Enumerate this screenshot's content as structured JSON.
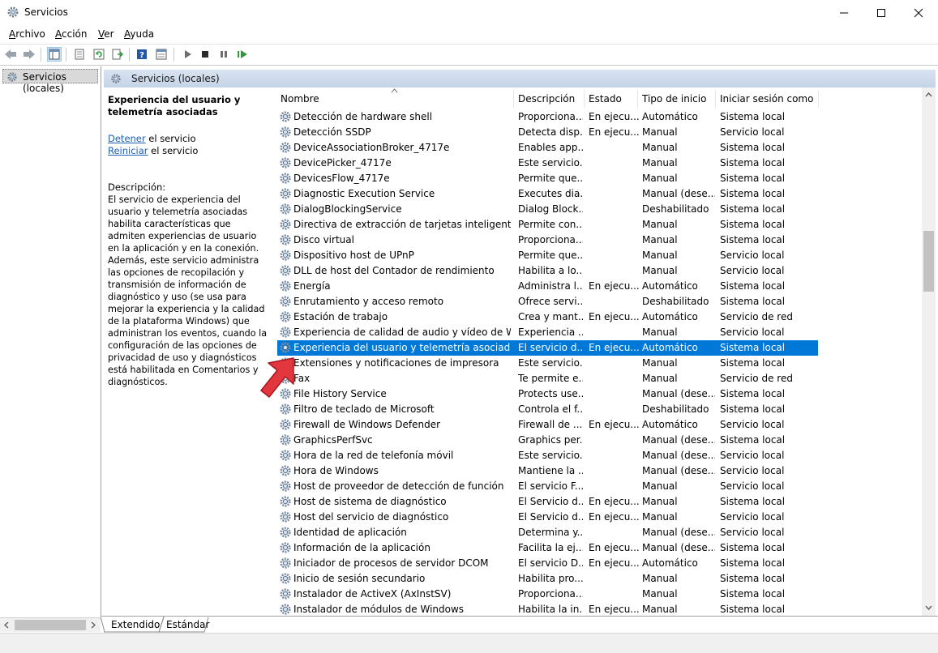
{
  "window": {
    "title": "Servicios"
  },
  "menu": [
    {
      "label": "Archivo",
      "ul": "A",
      "rest": "rchivo"
    },
    {
      "label": "Acción",
      "ul": "A",
      "rest": "cción"
    },
    {
      "label": "Ver",
      "ul": "V",
      "rest": "er"
    },
    {
      "label": "Ayuda",
      "ul": "A",
      "rest": "yuda"
    }
  ],
  "tree": {
    "item": "Servicios (locales)"
  },
  "pane": {
    "header": "Servicios (locales)"
  },
  "detail": {
    "title": "Experiencia del usuario y telemetría asociadas",
    "stop_link": "Detener",
    "stop_rest": " el servicio",
    "restart_link": "Reiniciar",
    "restart_rest": " el servicio",
    "desc_label": "Descripción:",
    "description": "El servicio de experiencia del usuario y telemetría asociadas habilita características que admiten experiencias de usuario en la aplicación y en la conexión. Además, este servicio administra las opciones de recopilación y transmisión de información de diagnóstico y uso (se usa para mejorar la experiencia y la calidad de la plataforma Windows) que administran los eventos, cuando la configuración de las opciones de privacidad de uso y diagnósticos está habilitada en Comentarios y diagnósticos."
  },
  "columns": {
    "name": "Nombre",
    "description": "Descripción",
    "status": "Estado",
    "startup": "Tipo de inicio",
    "logon": "Iniciar sesión como"
  },
  "services": [
    {
      "name": "Detección de hardware shell",
      "desc": "Proporciona...",
      "status": "En ejecu...",
      "startup": "Automático",
      "logon": "Sistema local"
    },
    {
      "name": "Detección SSDP",
      "desc": "Detecta disp...",
      "status": "En ejecu...",
      "startup": "Manual",
      "logon": "Servicio local"
    },
    {
      "name": "DeviceAssociationBroker_4717e",
      "desc": "Enables app...",
      "status": "",
      "startup": "Manual",
      "logon": "Sistema local"
    },
    {
      "name": "DevicePicker_4717e",
      "desc": "Este servicio...",
      "status": "",
      "startup": "Manual",
      "logon": "Sistema local"
    },
    {
      "name": "DevicesFlow_4717e",
      "desc": "Permite que...",
      "status": "",
      "startup": "Manual",
      "logon": "Sistema local"
    },
    {
      "name": "Diagnostic Execution Service",
      "desc": "Executes dia...",
      "status": "",
      "startup": "Manual (dese...",
      "logon": "Sistema local"
    },
    {
      "name": "DialogBlockingService",
      "desc": "Dialog Block...",
      "status": "",
      "startup": "Deshabilitado",
      "logon": "Sistema local"
    },
    {
      "name": "Directiva de extracción de tarjetas inteligentes",
      "desc": "Permite con...",
      "status": "",
      "startup": "Manual",
      "logon": "Sistema local"
    },
    {
      "name": "Disco virtual",
      "desc": "Proporciona...",
      "status": "",
      "startup": "Manual",
      "logon": "Sistema local"
    },
    {
      "name": "Dispositivo host de UPnP",
      "desc": "Permite que...",
      "status": "",
      "startup": "Manual",
      "logon": "Servicio local"
    },
    {
      "name": "DLL de host del Contador de rendimiento",
      "desc": "Habilita a lo...",
      "status": "",
      "startup": "Manual",
      "logon": "Servicio local"
    },
    {
      "name": "Energía",
      "desc": "Administra l...",
      "status": "En ejecu...",
      "startup": "Automático",
      "logon": "Sistema local"
    },
    {
      "name": "Enrutamiento y acceso remoto",
      "desc": "Ofrece servi...",
      "status": "",
      "startup": "Deshabilitado",
      "logon": "Sistema local"
    },
    {
      "name": "Estación de trabajo",
      "desc": "Crea y mant...",
      "status": "En ejecu...",
      "startup": "Automático",
      "logon": "Servicio de red"
    },
    {
      "name": "Experiencia de calidad de audio y vídeo de Wind...",
      "desc": "Experiencia ...",
      "status": "",
      "startup": "Manual",
      "logon": "Servicio local"
    },
    {
      "name": "Experiencia del usuario y telemetría asociadas",
      "desc": "El servicio d...",
      "status": "En ejecu...",
      "startup": "Automático",
      "logon": "Sistema local",
      "selected": true
    },
    {
      "name": "Extensiones y notificaciones de impresora",
      "desc": "Este servicio...",
      "status": "",
      "startup": "Manual",
      "logon": "Sistema local"
    },
    {
      "name": "Fax",
      "desc": "Te permite e...",
      "status": "",
      "startup": "Manual",
      "logon": "Servicio de red"
    },
    {
      "name": "File History Service",
      "desc": "Protects use...",
      "status": "",
      "startup": "Manual (dese...",
      "logon": "Sistema local"
    },
    {
      "name": "Filtro de teclado de Microsoft",
      "desc": "Controla el f...",
      "status": "",
      "startup": "Deshabilitado",
      "logon": "Sistema local"
    },
    {
      "name": "Firewall de Windows Defender",
      "desc": "Firewall de ...",
      "status": "En ejecu...",
      "startup": "Automático",
      "logon": "Servicio local"
    },
    {
      "name": "GraphicsPerfSvc",
      "desc": "Graphics per...",
      "status": "",
      "startup": "Manual (dese...",
      "logon": "Sistema local"
    },
    {
      "name": "Hora de la red de telefonía móvil",
      "desc": "Este servicio...",
      "status": "",
      "startup": "Manual (dese...",
      "logon": "Servicio local"
    },
    {
      "name": "Hora de Windows",
      "desc": "Mantiene la ...",
      "status": "",
      "startup": "Manual (dese...",
      "logon": "Servicio local"
    },
    {
      "name": "Host de proveedor de detección de función",
      "desc": "El servicio F...",
      "status": "",
      "startup": "Manual",
      "logon": "Servicio local"
    },
    {
      "name": "Host de sistema de diagnóstico",
      "desc": "El Servicio d...",
      "status": "En ejecu...",
      "startup": "Manual",
      "logon": "Sistema local"
    },
    {
      "name": "Host del servicio de diagnóstico",
      "desc": "El Servicio d...",
      "status": "En ejecu...",
      "startup": "Manual",
      "logon": "Servicio local"
    },
    {
      "name": "Identidad de aplicación",
      "desc": "Determina y...",
      "status": "",
      "startup": "Manual (dese...",
      "logon": "Servicio local"
    },
    {
      "name": "Información de la aplicación",
      "desc": "Facilita la ej...",
      "status": "En ejecu...",
      "startup": "Manual (dese...",
      "logon": "Sistema local"
    },
    {
      "name": "Iniciador de procesos de servidor DCOM",
      "desc": "El servicio D...",
      "status": "En ejecu...",
      "startup": "Automático",
      "logon": "Sistema local"
    },
    {
      "name": "Inicio de sesión secundario",
      "desc": "Habilita pro...",
      "status": "",
      "startup": "Manual",
      "logon": "Sistema local"
    },
    {
      "name": "Instalador de ActiveX (AxInstSV)",
      "desc": "Proporciona...",
      "status": "",
      "startup": "Manual",
      "logon": "Sistema local"
    },
    {
      "name": "Instalador de módulos de Windows",
      "desc": "Habilita la in...",
      "status": "En ejecu...",
      "startup": "Manual",
      "logon": "Sistema local"
    }
  ],
  "tabs": {
    "extended": "Extendido",
    "standard": "Estándar"
  },
  "colors": {
    "selection": "#0078d7",
    "link": "#1e5fb4",
    "arrow": "#e2373f"
  },
  "icons": [
    "services-gear-icon",
    "minimize-icon",
    "maximize-icon",
    "close-icon",
    "back-icon",
    "forward-icon",
    "play-icon",
    "stop-icon",
    "pause-icon",
    "resume-icon",
    "sort-up-icon",
    "pointer-arrow-icon"
  ]
}
